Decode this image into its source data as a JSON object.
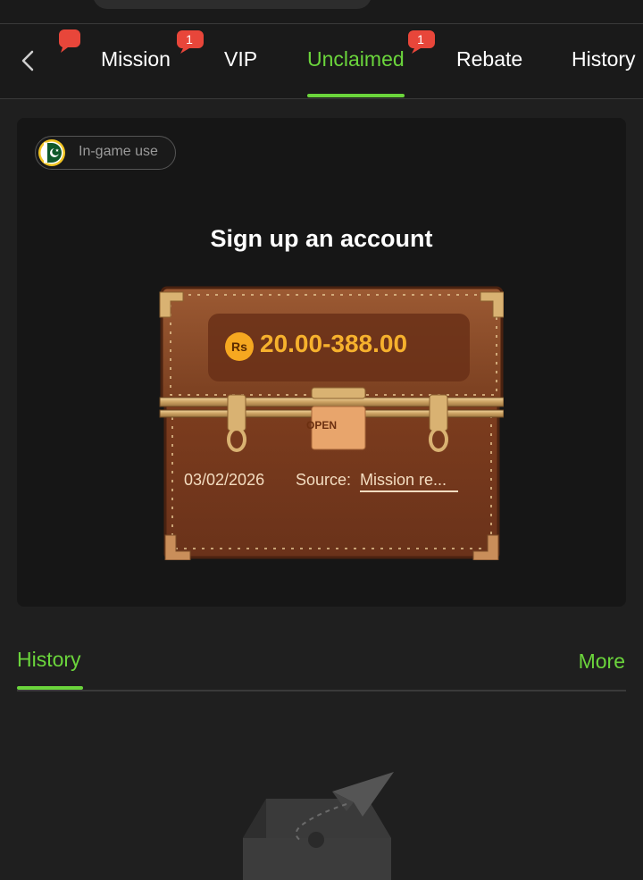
{
  "tabs": [
    {
      "label": "Mission",
      "badge": "1"
    },
    {
      "label": "VIP"
    },
    {
      "label": "Unclaimed",
      "badge": "1",
      "active": true
    },
    {
      "label": "Rebate"
    },
    {
      "label": "History"
    }
  ],
  "card": {
    "tag_label": "In-game use",
    "title": "Sign up an account",
    "currency_symbol": "Rs",
    "amount_range": "20.00-388.00",
    "open_label": "OPEN",
    "date": "03/02/2026",
    "source_label": "Source:",
    "source_value": "Mission re..."
  },
  "history": {
    "title": "History",
    "more_label": "More"
  },
  "colors": {
    "accent": "#6bd53c",
    "badge": "#e8463a",
    "amount": "#f6b12d",
    "chest": "#8a4a2a"
  },
  "icons": {
    "back": "chevron-left-icon",
    "flag": "pakistan-flag-icon",
    "empty": "empty-box-paper-plane-icon"
  }
}
